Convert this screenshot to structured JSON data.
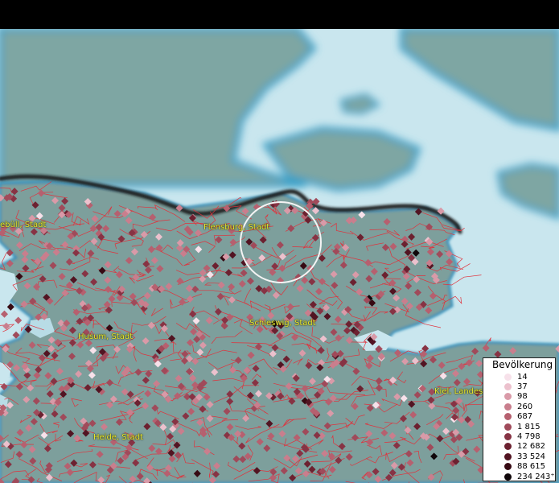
{
  "places": [
    {
      "name": "Niebüll, Stadt",
      "label": "ebüll, Stadt"
    },
    {
      "name": "Flensburg, Stadt",
      "label": "Flensburg, Stadt"
    },
    {
      "name": "Schleswig, Stadt",
      "label": "Schleswig, Stadt"
    },
    {
      "name": "Husum, Stadt",
      "label": "Husum, Stadt"
    },
    {
      "name": "Kiel, Landeshauptstadt",
      "label": "Kiel, Landes"
    },
    {
      "name": "Heide, Stadt",
      "label": "Heide, Stadt"
    }
  ],
  "legend": {
    "title": "Bevölkerung",
    "classes": [
      {
        "label": "14",
        "color": "#f7e1ea"
      },
      {
        "label": "37",
        "color": "#ecc1cd"
      },
      {
        "label": "98",
        "color": "#d99aa8"
      },
      {
        "label": "260",
        "color": "#c97e8d"
      },
      {
        "label": "687",
        "color": "#b6606f"
      },
      {
        "label": "1 815",
        "color": "#a04a5a"
      },
      {
        "label": "4 798",
        "color": "#873344"
      },
      {
        "label": "12 682",
        "color": "#6c2130"
      },
      {
        "label": "33 524",
        "color": "#521422"
      },
      {
        "label": "88 615",
        "color": "#370a13"
      },
      {
        "label": "234 243⁺",
        "color": "#10070a"
      }
    ]
  },
  "colors": {
    "water": "#c9e6ee",
    "land_outside": "#7ea6a3",
    "shore": "#3aa0c8",
    "municipality_border": "#e0323c",
    "national_border": "#1e1e1e",
    "label_text": "#e8e832"
  }
}
